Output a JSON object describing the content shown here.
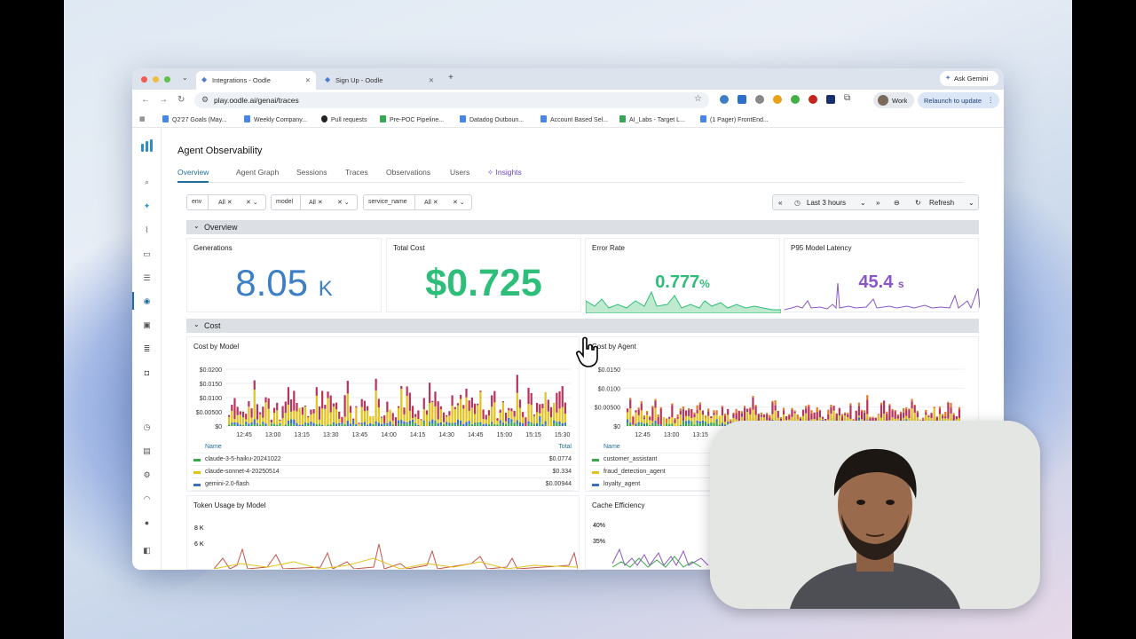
{
  "browser": {
    "tabs": [
      {
        "label": "Integrations - Oodle",
        "active": true
      },
      {
        "label": "Sign Up - Oodle",
        "active": false
      }
    ],
    "new_tab": "+",
    "ask_gemini": "Ask Gemini",
    "url": "play.oodle.ai/genai/traces",
    "profile": "Work",
    "relaunch": "Relaunch to update",
    "bookmarks": [
      "Q2'27 Goals (May...",
      "Weekly Company...",
      "Pull requests",
      "Pre-POC Pipeline...",
      "Datadog Outboun...",
      "Account Based Sel...",
      "AI_Labs - Target L...",
      "(1 Pager) FrontEnd..."
    ]
  },
  "page": {
    "title": "Agent Observability",
    "tabs": [
      "Overview",
      "Agent Graph",
      "Sessions",
      "Traces",
      "Observations",
      "Users",
      "Insights"
    ],
    "active_tab": "Overview",
    "filters": [
      {
        "key": "env",
        "value": "All"
      },
      {
        "key": "model",
        "value": "All"
      },
      {
        "key": "service_name",
        "value": "All"
      }
    ],
    "time_range": "Last 3 hours",
    "refresh": "Refresh"
  },
  "overview": {
    "section": "Overview",
    "cards": [
      {
        "title": "Generations",
        "value": "8.05",
        "unit": "K",
        "color": "#3b7fc4"
      },
      {
        "title": "Total Cost",
        "value": "$0.725",
        "unit": "",
        "color": "#2dbf7a"
      },
      {
        "title": "Error Rate",
        "value": "0.777",
        "unit": "%",
        "color": "#2dbf7a"
      },
      {
        "title": "P95 Model Latency",
        "value": "45.4",
        "unit": "s",
        "color": "#8a55c8"
      }
    ]
  },
  "cost": {
    "section": "Cost",
    "by_model": {
      "title": "Cost by Model",
      "yticks": [
        "$0.0200",
        "$0.0150",
        "$0.0100",
        "$0.00500",
        "$0"
      ],
      "xticks": [
        "12:45",
        "13:00",
        "13:15",
        "13:30",
        "13:45",
        "14:00",
        "14:15",
        "14:30",
        "14:45",
        "15:00",
        "15:15",
        "15:30"
      ],
      "legend_header": {
        "name": "Name",
        "total": "Total"
      },
      "legend": [
        {
          "name": "claude-3-5-haiku-20241022",
          "total": "$0.0774",
          "color": "#3aa84a"
        },
        {
          "name": "claude-sonnet-4-20250514",
          "total": "$0.334",
          "color": "#e3c21b"
        },
        {
          "name": "gemini-2.0-flash",
          "total": "$0.00944",
          "color": "#3b6fc4"
        }
      ]
    },
    "by_agent": {
      "title": "Cost by Agent",
      "yticks": [
        "$0.0150",
        "$0.0100",
        "$0.00500",
        "$0"
      ],
      "xticks": [
        "12:45",
        "13:00",
        "13:15"
      ],
      "legend_header": {
        "name": "Name"
      },
      "legend": [
        {
          "name": "customer_assistant",
          "color": "#3aa84a"
        },
        {
          "name": "fraud_detection_agent",
          "color": "#e3c21b"
        },
        {
          "name": "loyalty_agent",
          "color": "#3b6fc4"
        }
      ]
    },
    "token_usage": {
      "title": "Token Usage by Model",
      "yticks": [
        "8 K",
        "6 K"
      ]
    },
    "cache_efficiency": {
      "title": "Cache Efficiency",
      "yticks": [
        "40%",
        "35%"
      ]
    }
  },
  "colors": {
    "accent": "#1f6f9e",
    "insights": "#6a45c9",
    "bar_red": "#b8325a",
    "bar_yellow": "#e3c21b",
    "bar_green": "#3aa84a",
    "bar_blue": "#3b6fc4"
  },
  "icons": [
    "search-icon",
    "sparkle-icon",
    "chart-icon",
    "mail-icon",
    "list-icon",
    "eye-icon",
    "monitor-icon",
    "database-icon",
    "bell-icon",
    "clock-icon",
    "desktop-icon",
    "gear-icon",
    "headset-icon",
    "circle-icon",
    "panel-icon",
    "refresh-icon",
    "zoom-out-icon",
    "cursor-hand-icon"
  ]
}
